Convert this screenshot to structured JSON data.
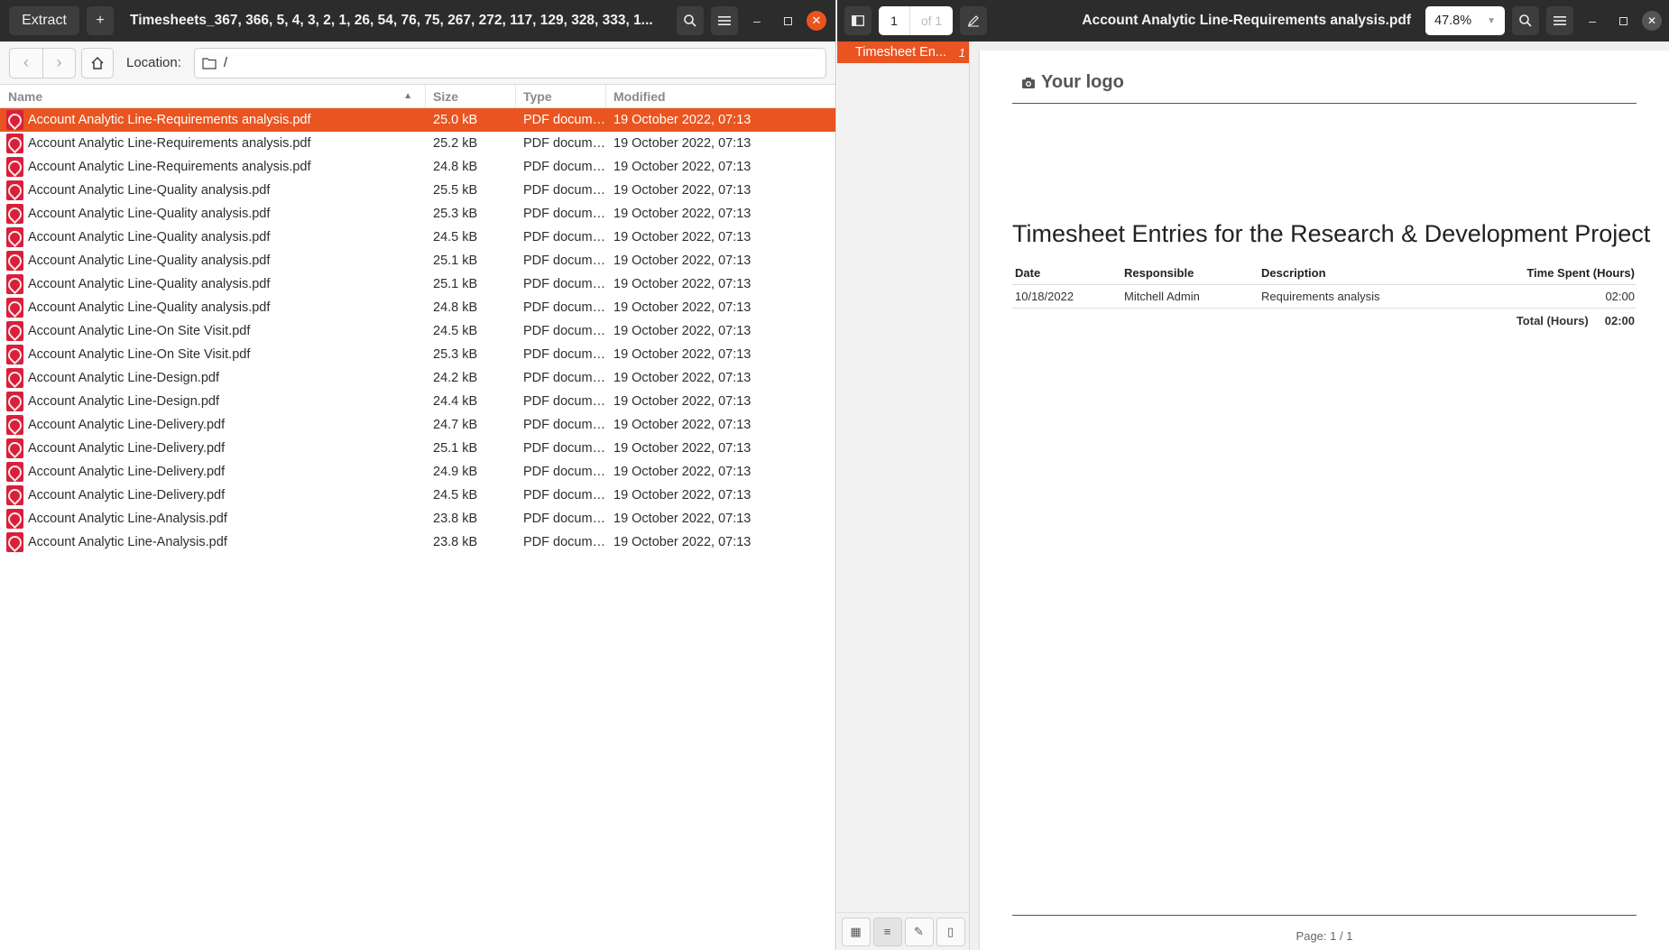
{
  "archive": {
    "extract_label": "Extract",
    "add_label": "+",
    "title": "Timesheets_367, 366, 5, 4, 3, 2, 1, 26, 54, 76, 75, 267, 272, 117, 129, 328, 333, 1...",
    "location_label": "Location:",
    "location_value": "/",
    "columns": {
      "name": "Name",
      "size": "Size",
      "type": "Type",
      "modified": "Modified"
    },
    "files": [
      {
        "name": "Account Analytic Line-Requirements analysis.pdf",
        "size": "25.0 kB",
        "type": "PDF document",
        "modified": "19 October 2022, 07:13"
      },
      {
        "name": "Account Analytic Line-Requirements analysis.pdf",
        "size": "25.2 kB",
        "type": "PDF document",
        "modified": "19 October 2022, 07:13"
      },
      {
        "name": "Account Analytic Line-Requirements analysis.pdf",
        "size": "24.8 kB",
        "type": "PDF document",
        "modified": "19 October 2022, 07:13"
      },
      {
        "name": "Account Analytic Line-Quality analysis.pdf",
        "size": "25.5 kB",
        "type": "PDF document",
        "modified": "19 October 2022, 07:13"
      },
      {
        "name": "Account Analytic Line-Quality analysis.pdf",
        "size": "25.3 kB",
        "type": "PDF document",
        "modified": "19 October 2022, 07:13"
      },
      {
        "name": "Account Analytic Line-Quality analysis.pdf",
        "size": "24.5 kB",
        "type": "PDF document",
        "modified": "19 October 2022, 07:13"
      },
      {
        "name": "Account Analytic Line-Quality analysis.pdf",
        "size": "25.1 kB",
        "type": "PDF document",
        "modified": "19 October 2022, 07:13"
      },
      {
        "name": "Account Analytic Line-Quality analysis.pdf",
        "size": "25.1 kB",
        "type": "PDF document",
        "modified": "19 October 2022, 07:13"
      },
      {
        "name": "Account Analytic Line-Quality analysis.pdf",
        "size": "24.8 kB",
        "type": "PDF document",
        "modified": "19 October 2022, 07:13"
      },
      {
        "name": "Account Analytic Line-On Site Visit.pdf",
        "size": "24.5 kB",
        "type": "PDF document",
        "modified": "19 October 2022, 07:13"
      },
      {
        "name": "Account Analytic Line-On Site Visit.pdf",
        "size": "25.3 kB",
        "type": "PDF document",
        "modified": "19 October 2022, 07:13"
      },
      {
        "name": "Account Analytic Line-Design.pdf",
        "size": "24.2 kB",
        "type": "PDF document",
        "modified": "19 October 2022, 07:13"
      },
      {
        "name": "Account Analytic Line-Design.pdf",
        "size": "24.4 kB",
        "type": "PDF document",
        "modified": "19 October 2022, 07:13"
      },
      {
        "name": "Account Analytic Line-Delivery.pdf",
        "size": "24.7 kB",
        "type": "PDF document",
        "modified": "19 October 2022, 07:13"
      },
      {
        "name": "Account Analytic Line-Delivery.pdf",
        "size": "25.1 kB",
        "type": "PDF document",
        "modified": "19 October 2022, 07:13"
      },
      {
        "name": "Account Analytic Line-Delivery.pdf",
        "size": "24.9 kB",
        "type": "PDF document",
        "modified": "19 October 2022, 07:13"
      },
      {
        "name": "Account Analytic Line-Delivery.pdf",
        "size": "24.5 kB",
        "type": "PDF document",
        "modified": "19 October 2022, 07:13"
      },
      {
        "name": "Account Analytic Line-Analysis.pdf",
        "size": "23.8 kB",
        "type": "PDF document",
        "modified": "19 October 2022, 07:13"
      },
      {
        "name": "Account Analytic Line-Analysis.pdf",
        "size": "23.8 kB",
        "type": "PDF document",
        "modified": "19 October 2022, 07:13"
      }
    ]
  },
  "viewer": {
    "page_current": "1",
    "page_of": "of 1",
    "title": "Account Analytic Line-Requirements analysis.pdf",
    "zoom": "47.8%",
    "outline_item": "Timesheet En...",
    "outline_page": "1",
    "doc": {
      "logo_text": "Your logo",
      "title": "Timesheet Entries for the Research & Development Project",
      "headers": {
        "date": "Date",
        "responsible": "Responsible",
        "description": "Description",
        "time": "Time Spent (Hours)"
      },
      "entries": [
        {
          "date": "10/18/2022",
          "responsible": "Mitchell Admin",
          "description": "Requirements analysis",
          "time": "02:00"
        }
      ],
      "total_label": "Total (Hours)",
      "total_value": "02:00",
      "page_footer": "Page: 1 / 1"
    }
  },
  "colors": {
    "accent": "#e95420",
    "headerbar": "#2c2c2c",
    "pdf_icon": "#d8203a"
  }
}
